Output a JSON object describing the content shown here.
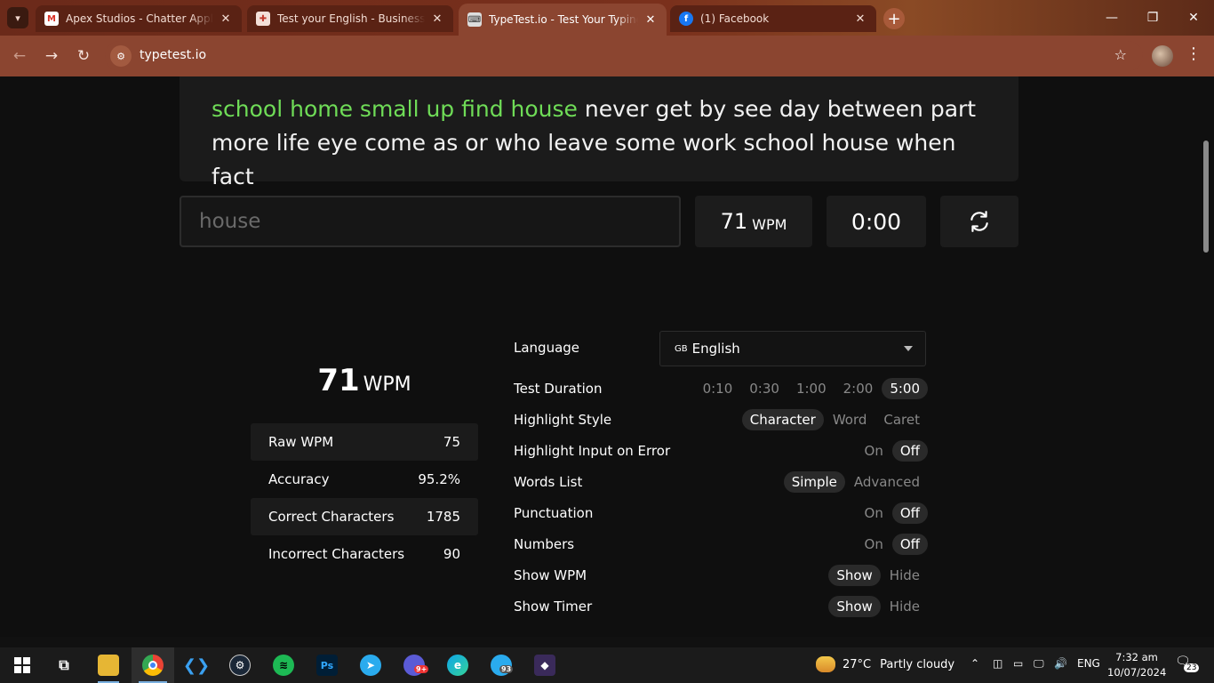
{
  "browser": {
    "tabs": [
      {
        "title": "Apex Studios - Chatter Applic",
        "icon": "gmail-icon"
      },
      {
        "title": "Test your English - Business Eng",
        "icon": "cambridge-icon"
      },
      {
        "title": "TypeTest.io - Test Your Typing Sp",
        "icon": "typetest-icon",
        "active": true
      },
      {
        "title": "(1) Facebook",
        "icon": "facebook-icon"
      }
    ],
    "url": "typetest.io"
  },
  "test": {
    "typed_text": "school home small up find house",
    "remaining_line1": " never get by see day between part",
    "line2": "more life eye come as or who leave some work school house when fact",
    "input_value": "house",
    "wpm_value": "71",
    "wpm_unit": "WPM",
    "timer": "0:00"
  },
  "results": {
    "wpm": "71",
    "wpm_unit": "WPM",
    "rows": [
      {
        "label": "Raw WPM",
        "value": "75"
      },
      {
        "label": "Accuracy",
        "value": "95.2%"
      },
      {
        "label": "Correct Characters",
        "value": "1785"
      },
      {
        "label": "Incorrect Characters",
        "value": "90"
      }
    ]
  },
  "settings": {
    "language_label": "Language",
    "language_flag": "GB",
    "language_value": "English",
    "rows": [
      {
        "label": "Test Duration",
        "options": [
          "0:10",
          "0:30",
          "1:00",
          "2:00",
          "5:00"
        ],
        "selected": "5:00"
      },
      {
        "label": "Highlight Style",
        "options": [
          "Character",
          "Word",
          "Caret"
        ],
        "selected": "Character"
      },
      {
        "label": "Highlight Input on Error",
        "options": [
          "On",
          "Off"
        ],
        "selected": "Off"
      },
      {
        "label": "Words List",
        "options": [
          "Simple",
          "Advanced"
        ],
        "selected": "Simple"
      },
      {
        "label": "Punctuation",
        "options": [
          "On",
          "Off"
        ],
        "selected": "Off"
      },
      {
        "label": "Numbers",
        "options": [
          "On",
          "Off"
        ],
        "selected": "Off"
      },
      {
        "label": "Show WPM",
        "options": [
          "Show",
          "Hide"
        ],
        "selected": "Show"
      },
      {
        "label": "Show Timer",
        "options": [
          "Show",
          "Hide"
        ],
        "selected": "Show"
      }
    ]
  },
  "taskbar": {
    "weather_temp": "27°C",
    "weather_desc": "Partly cloudy",
    "lang": "ENG",
    "time": "7:32 am",
    "date": "10/07/2024",
    "notif_count": "23",
    "telegram_badge": "93",
    "app_badge": "9+"
  },
  "colors": {
    "typed_green": "#6fdc57",
    "chrome_brown": "#8b4530",
    "page_bg": "#0f0f0f"
  }
}
